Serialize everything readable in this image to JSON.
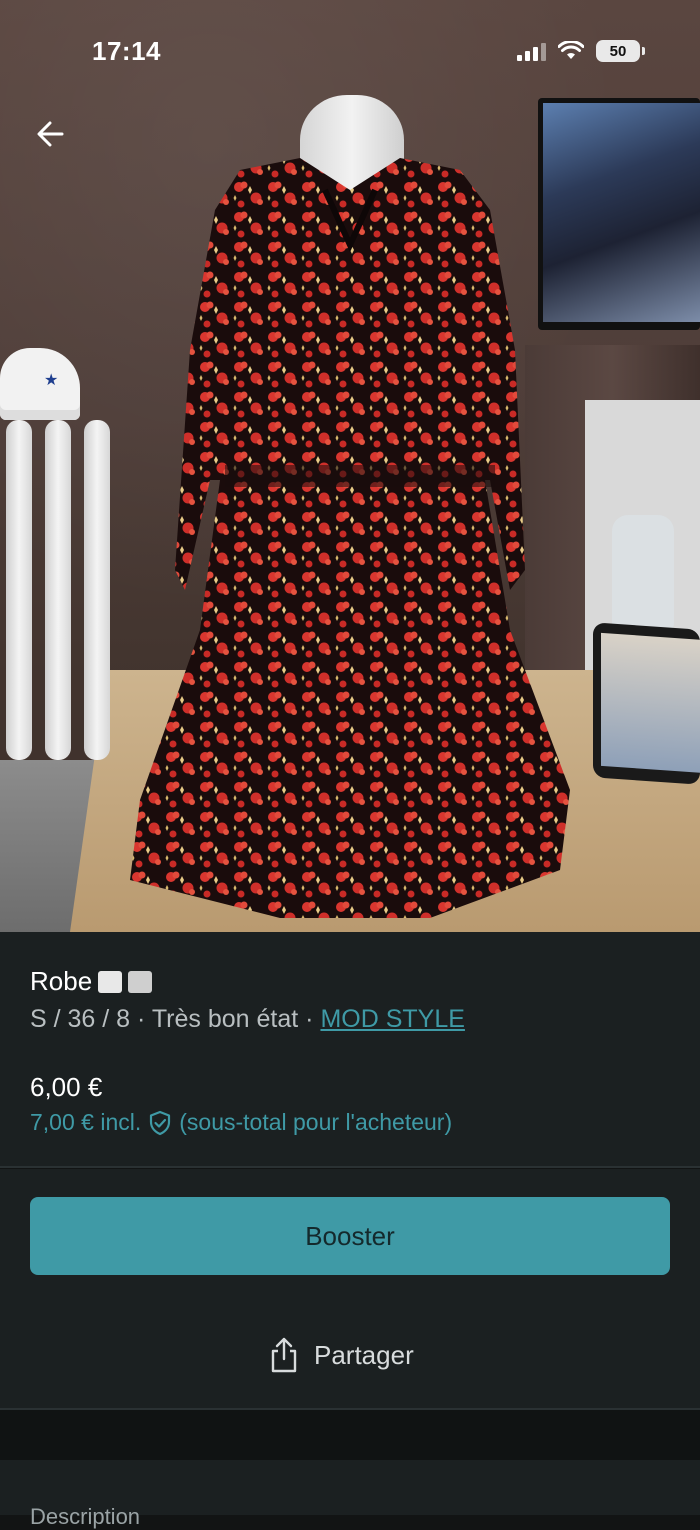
{
  "status_bar": {
    "time": "17:14",
    "battery": "50"
  },
  "item": {
    "title": "Robe",
    "size": "S / 36 / 8",
    "separator": "·",
    "condition": "Très bon état",
    "brand": "MOD STYLE",
    "price": "6,00 €",
    "price_incl": "7,00 € incl.",
    "price_incl_note": "(sous-total pour l'acheteur)"
  },
  "actions": {
    "boost_label": "Booster",
    "share_label": "Partager"
  },
  "sections": {
    "description_label": "Description"
  },
  "colors": {
    "accent": "#3f9aa6",
    "background": "#1b2021"
  },
  "icons": [
    "back-arrow-icon",
    "signal-icon",
    "wifi-icon",
    "battery-icon",
    "buyer-protection-shield-icon",
    "share-icon"
  ]
}
